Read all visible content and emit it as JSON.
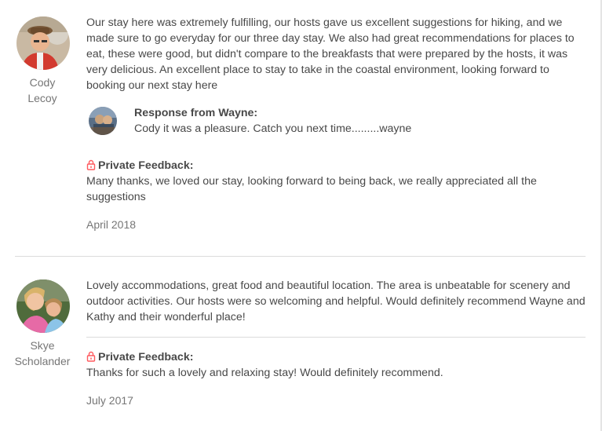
{
  "reviews": [
    {
      "reviewer_first": "Cody",
      "reviewer_last": "Lecoy",
      "text": "Our stay here was extremely fulfilling, our hosts gave us excellent suggestions for hiking, and we made sure to go everyday for our three day stay. We also had great recommendations for places to eat, these were good, but didn't compare to the breakfasts that were prepared by the hosts, it was very delicious. An excellent place to stay to take in the coastal environment, looking forward to booking our next stay here",
      "response_title": "Response from Wayne:",
      "response_text": "Cody it was a pleasure. Catch you next time.........wayne",
      "private_feedback_label": "Private Feedback:",
      "private_feedback_text": "Many thanks, we loved our stay, looking forward to being back, we really appreciated all the suggestions",
      "date": "April 2018"
    },
    {
      "reviewer_first": "Skye",
      "reviewer_last": "Scholander",
      "text": "Lovely accommodations, great food and beautiful location. The area is unbeatable for scenery and outdoor activities. Our hosts were so welcoming and helpful. Would definitely recommend Wayne and Kathy and their wonderful place!",
      "private_feedback_label": "Private Feedback:",
      "private_feedback_text": "Thanks for such a lovely and relaxing stay! Would definitely recommend.",
      "date": "July 2017"
    }
  ],
  "colors": {
    "text": "#484848",
    "muted": "#767676",
    "divider": "#dcdcdc",
    "lock_icon": "#ff5a5f"
  },
  "icons": {
    "lock": "lock-icon"
  }
}
